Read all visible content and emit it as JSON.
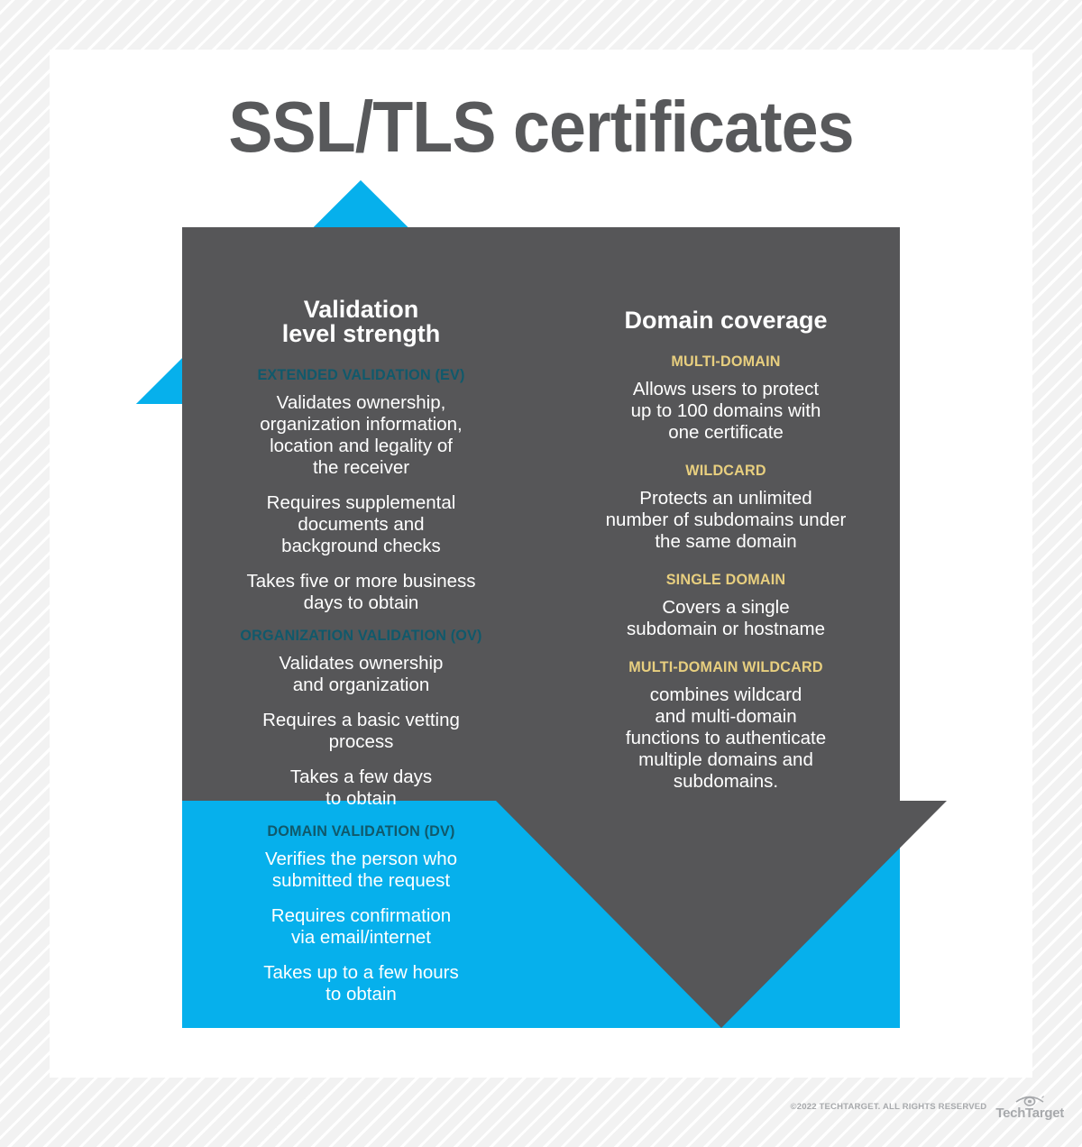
{
  "title": "SSL/TLS certificates",
  "colors": {
    "blue": "#06b0ec",
    "gray": "#565658",
    "title_gray": "#58595b",
    "left_heading": "#10596b",
    "right_heading": "#e8cf7f",
    "body_text": "#ffffff",
    "card": "#ffffff"
  },
  "left_column": {
    "heading": "Validation\nlevel strength",
    "sections": [
      {
        "label": "EXTENDED VALIDATION (EV)",
        "bullets": [
          "Validates ownership,\norganization information,\nlocation and legality of\nthe receiver",
          "Requires supplemental\ndocuments and\nbackground checks",
          "Takes five or more business\ndays to obtain"
        ]
      },
      {
        "label": "ORGANIZATION VALIDATION (OV)",
        "bullets": [
          "Validates ownership\nand organization",
          "Requires a basic vetting\nprocess",
          "Takes a few days\nto obtain"
        ]
      },
      {
        "label": "DOMAIN VALIDATION (DV)",
        "bullets": [
          "Verifies the person who\nsubmitted the request",
          "Requires confirmation\nvia email/internet",
          "Takes up to a few hours\nto obtain"
        ]
      }
    ]
  },
  "right_column": {
    "heading": "Domain coverage",
    "sections": [
      {
        "label": "MULTI-DOMAIN",
        "bullets": [
          "Allows users to protect\nup to 100 domains with\none certificate"
        ]
      },
      {
        "label": "WILDCARD",
        "bullets": [
          "Protects an unlimited\nnumber of subdomains under\nthe same domain"
        ]
      },
      {
        "label": "SINGLE DOMAIN",
        "bullets": [
          "Covers a single\nsubdomain or hostname"
        ]
      },
      {
        "label": "MULTI-DOMAIN WILDCARD",
        "bullets": [
          "combines wildcard\nand multi-domain\nfunctions to authenticate\nmultiple domains and\nsubdomains."
        ]
      }
    ]
  },
  "footer": {
    "copyright": "©2022 TECHTARGET. ALL RIGHTS RESERVED",
    "brand": "TechTarget"
  }
}
